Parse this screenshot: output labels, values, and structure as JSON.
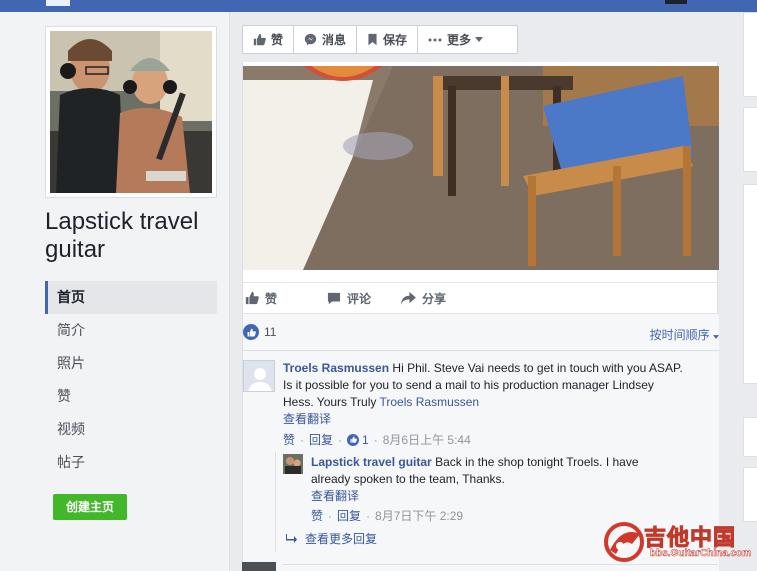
{
  "page": {
    "name": "Lapstick travel guitar"
  },
  "nav": {
    "items": [
      {
        "label": "首页",
        "active": true
      },
      {
        "label": "简介"
      },
      {
        "label": "照片"
      },
      {
        "label": "赞"
      },
      {
        "label": "视频"
      },
      {
        "label": "帖子"
      }
    ],
    "create_button": "创建主页"
  },
  "action_bar": {
    "like": "赞",
    "message": "消息",
    "save": "保存",
    "more": "更多"
  },
  "post": {
    "reactions": {
      "like": "赞",
      "comment": "评论",
      "share": "分享"
    },
    "likes_count": "11",
    "sort_label": "按时间顺序",
    "comments": [
      {
        "author": "Troels Rasmussen",
        "text": "Hi Phil. Steve Vai needs to get in touch with you ASAP. Is it possible for you to send a mail to his production manager Lindsey Hess. Yours Truly",
        "mention": "Troels Rasmussen",
        "translate": "查看翻译",
        "like": "赞",
        "reply": "回复",
        "like_count": "1",
        "time": "8月6日上午 5:44"
      }
    ],
    "reply": {
      "author": "Lapstick travel guitar",
      "text": "Back in the shop tonight Troels. I have already spoken to the team, Thanks.",
      "translate": "查看翻译",
      "like": "赞",
      "reply": "回复",
      "time": "8月7日下午 2:29"
    },
    "more_replies": "查看更多回复"
  },
  "watermark": {
    "title": "吉他中国",
    "url": "bbs.GuitarChina.com"
  },
  "colors": {
    "brand": "#4267b2",
    "link": "#385898",
    "green": "#42b72a"
  }
}
